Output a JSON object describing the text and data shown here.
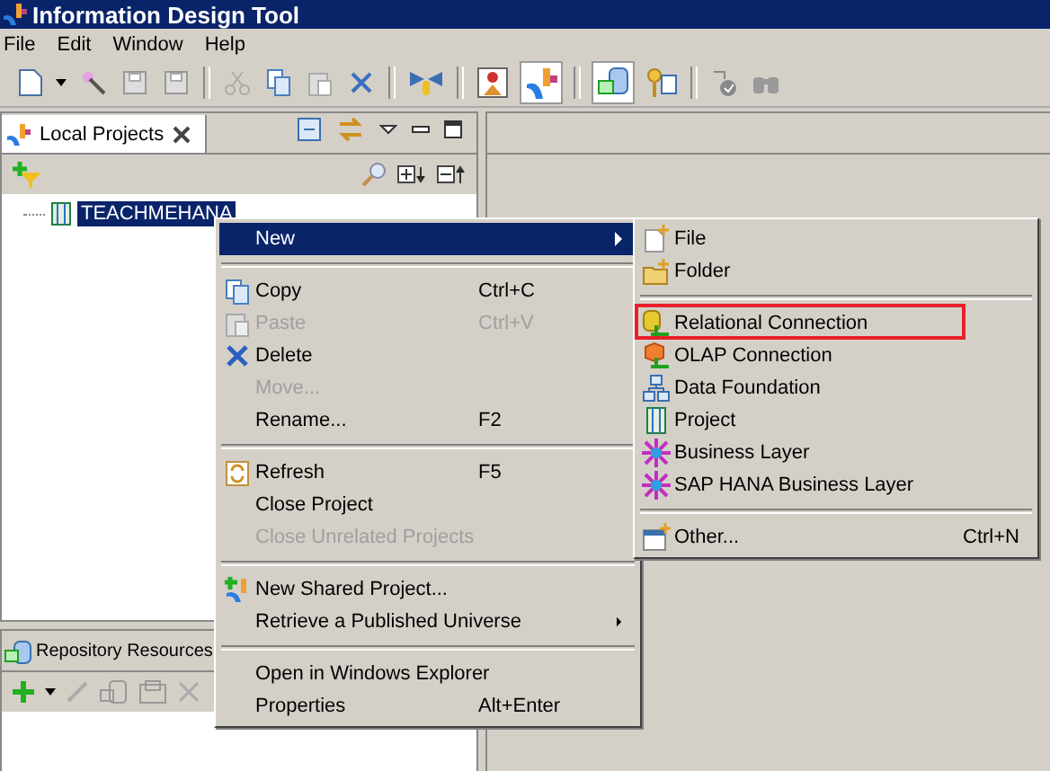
{
  "window": {
    "title": "Information Design Tool"
  },
  "menu_bar": [
    "File",
    "Edit",
    "Window",
    "Help"
  ],
  "local_projects": {
    "tab_title": "Local Projects",
    "tree": [
      {
        "label": "TEACHMEHANA",
        "selected": true
      }
    ]
  },
  "repository": {
    "tab_title": "Repository Resources"
  },
  "context_menu": [
    {
      "kind": "item",
      "label": "New",
      "disabled": false,
      "selected": true,
      "submenu": true
    },
    {
      "kind": "separator"
    },
    {
      "kind": "item",
      "label": "Copy",
      "shortcut": "Ctrl+C",
      "disabled": false,
      "selected": false,
      "submenu": false
    },
    {
      "kind": "item",
      "label": "Paste",
      "shortcut": "Ctrl+V",
      "disabled": true,
      "selected": false,
      "submenu": false
    },
    {
      "kind": "item",
      "label": "Delete",
      "disabled": false,
      "selected": false,
      "submenu": false
    },
    {
      "kind": "item",
      "label": "Move...",
      "disabled": true,
      "selected": false,
      "submenu": false
    },
    {
      "kind": "item",
      "label": "Rename...",
      "shortcut": "F2",
      "disabled": false,
      "selected": false,
      "submenu": false
    },
    {
      "kind": "separator"
    },
    {
      "kind": "item",
      "label": "Refresh",
      "shortcut": "F5",
      "disabled": false,
      "selected": false,
      "submenu": false
    },
    {
      "kind": "item",
      "label": "Close Project",
      "disabled": false,
      "selected": false,
      "submenu": false
    },
    {
      "kind": "item",
      "label": "Close Unrelated Projects",
      "disabled": true,
      "selected": false,
      "submenu": false
    },
    {
      "kind": "separator"
    },
    {
      "kind": "item",
      "label": "New Shared Project...",
      "disabled": false,
      "selected": false,
      "submenu": false
    },
    {
      "kind": "item",
      "label": "Retrieve a Published Universe",
      "disabled": false,
      "selected": false,
      "submenu": true
    },
    {
      "kind": "separator"
    },
    {
      "kind": "item",
      "label": "Open in Windows Explorer",
      "disabled": false,
      "selected": false,
      "submenu": false
    },
    {
      "kind": "item",
      "label": "Properties",
      "shortcut": "Alt+Enter",
      "disabled": false,
      "selected": false,
      "submenu": false
    }
  ],
  "new_submenu": [
    {
      "kind": "item",
      "label": "File",
      "highlighted": false
    },
    {
      "kind": "item",
      "label": "Folder",
      "highlighted": false
    },
    {
      "kind": "separator"
    },
    {
      "kind": "item",
      "label": "Relational Connection",
      "highlighted": true
    },
    {
      "kind": "item",
      "label": "OLAP Connection",
      "highlighted": false
    },
    {
      "kind": "item",
      "label": "Data Foundation",
      "highlighted": false
    },
    {
      "kind": "item",
      "label": "Project",
      "highlighted": false
    },
    {
      "kind": "item",
      "label": "Business Layer",
      "highlighted": false
    },
    {
      "kind": "item",
      "label": "SAP HANA Business Layer",
      "highlighted": false
    },
    {
      "kind": "separator"
    },
    {
      "kind": "item",
      "label": "Other...",
      "shortcut": "Ctrl+N",
      "highlighted": false
    }
  ]
}
